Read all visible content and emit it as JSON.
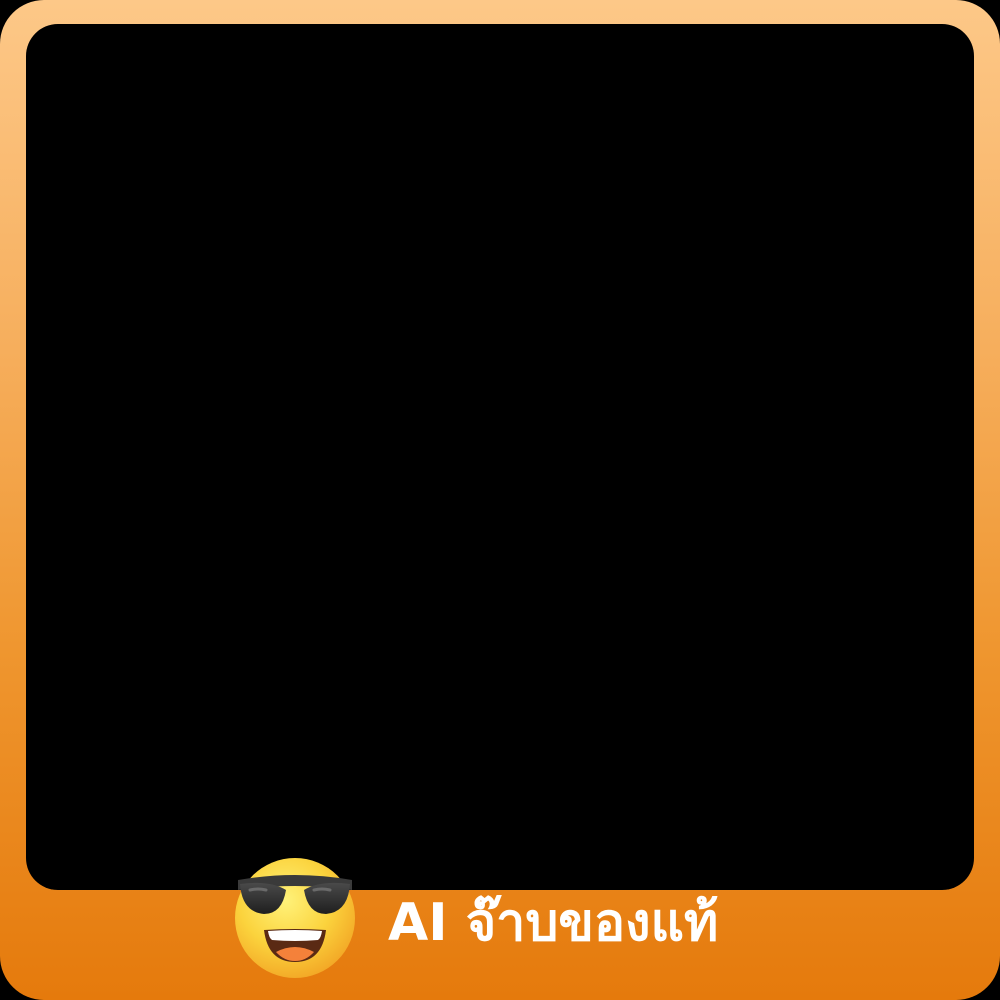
{
  "frame": {
    "caption": "AI จ๊าบของแท้",
    "emoji_icon": "smiling-face-with-sunglasses-icon"
  },
  "colors": {
    "frame_top": "#fdc888",
    "frame_bottom": "#e57a0c",
    "photo_area": "#000000",
    "caption_text": "#ffffff",
    "emoji_face": "#fbd33d",
    "emoji_glasses": "#3a3a3a"
  }
}
